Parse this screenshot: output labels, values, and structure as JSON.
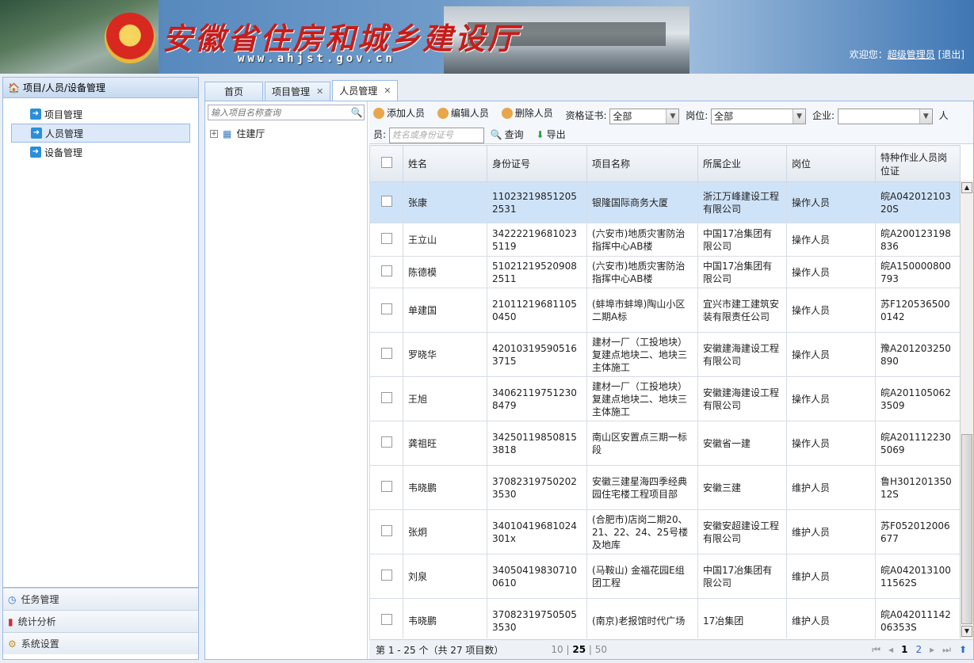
{
  "header": {
    "site_title": "安徽省住房和城乡建设厅",
    "site_url": "www.ahjst.gov.cn",
    "welcome_label": "欢迎您：",
    "user_name": "超级管理员",
    "logout_label": "[退出]"
  },
  "left_panel": {
    "title": "项目/人员/设备管理",
    "items": [
      {
        "label": "项目管理"
      },
      {
        "label": "人员管理"
      },
      {
        "label": "设备管理"
      }
    ],
    "sections": [
      {
        "label": "任务管理"
      },
      {
        "label": "统计分析"
      },
      {
        "label": "系统设置"
      }
    ]
  },
  "tabs": [
    {
      "label": "首页"
    },
    {
      "label": "项目管理"
    },
    {
      "label": "人员管理"
    }
  ],
  "tree": {
    "search_placeholder": "输入项目名称查询",
    "root_label": "住建厅"
  },
  "toolbar": {
    "add_label": "添加人员",
    "edit_label": "编辑人员",
    "delete_label": "删除人员",
    "cert_label": "资格证书:",
    "cert_value": "全部",
    "post_label": "岗位:",
    "post_value": "全部",
    "company_label": "企业:",
    "company_value": "",
    "person_label_part1": "人",
    "person_label_part2": "员:",
    "person_placeholder": "姓名或身份证号",
    "query_label": "查询",
    "export_label": "导出"
  },
  "grid": {
    "columns": [
      "姓名",
      "身份证号",
      "项目名称",
      "所属企业",
      "岗位",
      "特种作业人员岗位证"
    ],
    "rows": [
      [
        "张康",
        "110232198512052531",
        "银隆国际商务大厦",
        "浙江万峰建设工程有限公司",
        "操作人员",
        "皖A04201210320S"
      ],
      [
        "王立山",
        "342222196810235119",
        "(六安市)地质灾害防治指挥中心AB楼",
        "中国17冶集团有限公司",
        "操作人员",
        "皖A200123198836"
      ],
      [
        "陈德模",
        "510212195209082511",
        "(六安市)地质灾害防治指挥中心AB楼",
        "中国17冶集团有限公司",
        "操作人员",
        "皖A150000800793"
      ],
      [
        "单建国",
        "210112196811050450",
        "(蚌埠市蚌埠)陶山小区二期A标",
        "宜兴市建工建筑安装有限责任公司",
        "操作人员",
        "苏F1205365000142"
      ],
      [
        "罗晓华",
        "420103195905163715",
        "建材一厂（工投地块）复建点地块二、地块三主体施工",
        "安徽建海建设工程有限公司",
        "操作人员",
        "豫A201203250890"
      ],
      [
        "王旭",
        "340621197512308479",
        "建材一厂（工投地块）复建点地块二、地块三主体施工",
        "安徽建海建设工程有限公司",
        "操作人员",
        "皖A2011050623509"
      ],
      [
        "龚祖旺",
        "342501198508153818",
        "南山区安置点三期一标段",
        "安徽省一建",
        "操作人员",
        "皖A2011122305069"
      ],
      [
        "韦晓鹏",
        "370823197502023530",
        "安徽三建星海四季经典园住宅楼工程项目部",
        "安徽三建",
        "维护人员",
        "鲁H30120135012S"
      ],
      [
        "张炯",
        "34010419681024301x",
        "(合肥市)店岗二期20、21、22、24、25号楼及地库",
        "安徽安超建设工程有限公司",
        "维护人员",
        "苏F052012006677"
      ],
      [
        "刘泉",
        "340504198307100610",
        "(马鞍山) 金福花园E组团工程",
        "中国17冶集团有限公司",
        "维护人员",
        "皖A04201310011562S"
      ],
      [
        "韦晓鹏",
        "370823197505053530",
        "(南京)老报馆时代广场",
        "17冶集团",
        "维护人员",
        "皖A04201114206353S"
      ]
    ]
  },
  "pager": {
    "summary": "第 1 - 25 个（共 27 项目数）",
    "size_10": "10",
    "size_25": "25",
    "size_50": "50",
    "page_1": "1",
    "page_2": "2"
  }
}
